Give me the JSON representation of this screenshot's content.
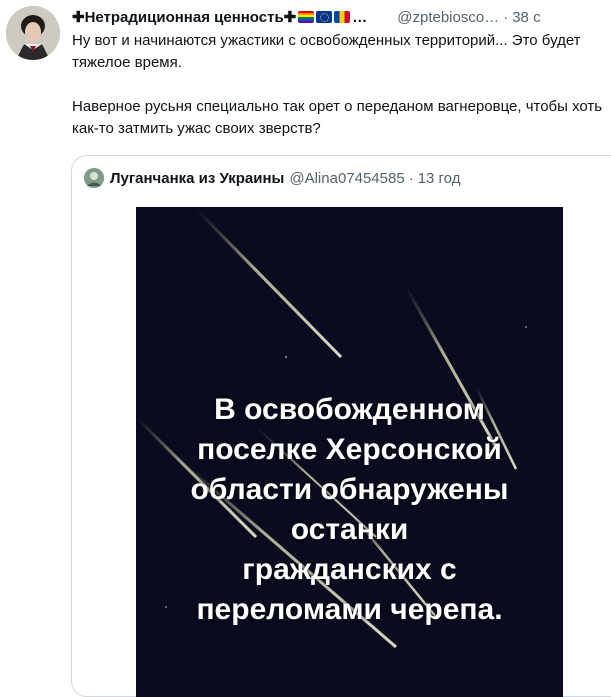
{
  "tweet": {
    "display_name": "✚Нетрадиционная ценность✚",
    "name_truncation": "…",
    "handle": "@zptebiosco…",
    "separator": "·",
    "time": "38 с",
    "paragraphs": [
      "Ну вот и начинаются ужастики с освобожденных территорий... Это будет тяжелое время.",
      "Наверное русьня специально так орет о переданом вагнеровце, чтобы хоть как-то затмить ужас своих зверств?"
    ],
    "flags": [
      "rainbow-flag-icon",
      "eu-flag-icon",
      "moldova-flag-icon"
    ]
  },
  "quote": {
    "display_name": "Луганчанка из Украины",
    "handle": "@Alina07454585",
    "separator": "·",
    "time": "13 год",
    "media": {
      "background": "#0a0b1f",
      "lines": [
        "В освобожденном",
        "поселке Херсонской",
        "области обнаружены",
        "останки",
        "гражданских с",
        "переломами черепа."
      ]
    }
  }
}
